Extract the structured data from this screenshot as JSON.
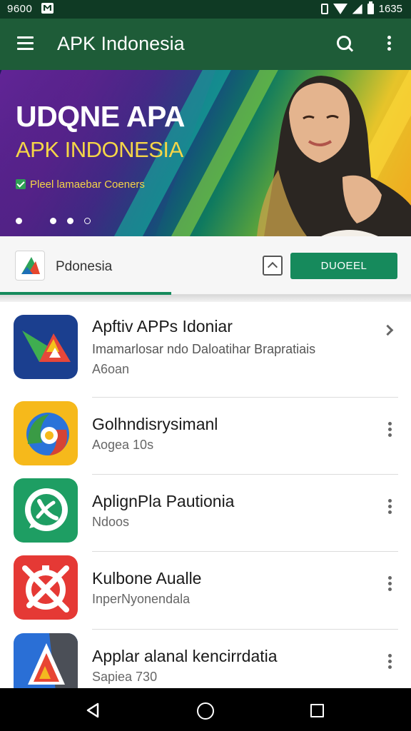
{
  "status_bar": {
    "time_left": "9600",
    "time_right": "1635",
    "icons": [
      "notification-icon",
      "vibrate-icon",
      "wifi-icon",
      "signal-icon",
      "battery-icon"
    ]
  },
  "app_bar": {
    "title": "APK Indonesia",
    "icons": [
      "menu-icon",
      "search-icon",
      "more-vert-icon"
    ]
  },
  "banner": {
    "title": "UDQNE APA",
    "subtitle": "APK INDONESIA",
    "tagline": "Pleel lamaebar Coeners",
    "pager": {
      "count": 4,
      "active_index": 0
    }
  },
  "featured": {
    "name": "Pdonesia",
    "button_label": "DUOEEL",
    "icons": [
      "brand-logo-icon",
      "chevron-up-icon"
    ]
  },
  "apps": [
    {
      "name": "Apftiv APPs Idoniar",
      "subtitle": "Imamarlosar ndo Daloatihar Brapratiais",
      "meta": "A6oan",
      "icon": "triangle-play-icon",
      "colors": [
        "#1b3f8f",
        "#3fae50",
        "#e6473a",
        "#f4c21b"
      ],
      "action": "chevron"
    },
    {
      "name": "Golhndisrysimanl",
      "subtitle": "",
      "meta": "Aogea 10s",
      "icon": "swirl-icon",
      "colors": [
        "#f6b91b",
        "#3a9b45",
        "#d64335",
        "#2a73d9"
      ],
      "action": "more"
    },
    {
      "name": "AplignPla Pautionia",
      "subtitle": "",
      "meta": "Ndoos",
      "icon": "chat-bubble-icon",
      "colors": [
        "#1e9e63",
        "#ffffff"
      ],
      "action": "more"
    },
    {
      "name": "Kulbone Aualle",
      "subtitle": "",
      "meta": "InperNyonendala",
      "icon": "cross-circle-icon",
      "colors": [
        "#e53935",
        "#ffffff"
      ],
      "action": "more"
    },
    {
      "name": "Applar alanal kencirrdatia",
      "subtitle": "",
      "meta": "Sapiea 730",
      "icon": "arrow-triangle-icon",
      "colors": [
        "#2a6fd6",
        "#e84533",
        "#f4b820",
        "#4b4f57"
      ],
      "action": "more"
    }
  ],
  "nav_bar": {
    "icons": [
      "back-icon",
      "home-icon",
      "recents-icon"
    ]
  }
}
